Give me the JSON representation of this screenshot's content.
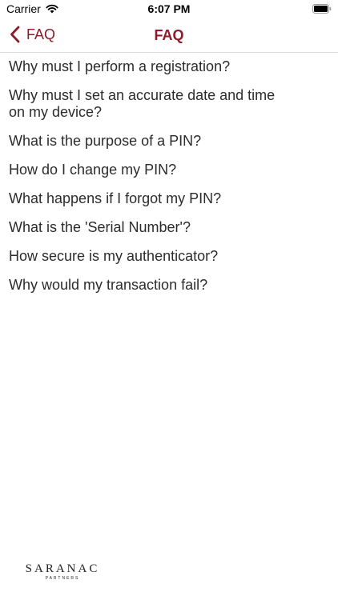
{
  "status_bar": {
    "carrier": "Carrier",
    "time": "6:07 PM"
  },
  "nav": {
    "back_label": "FAQ",
    "title": "FAQ",
    "accent_color": "#8a1c2b"
  },
  "faq": {
    "items": [
      "Why must I perform a registration?",
      "Why must I set an accurate date and time on my device?",
      "What is the purpose of a PIN?",
      "How do I change my PIN?",
      "What happens if I forgot my PIN?",
      "What is the 'Serial Number'?",
      "How secure is my authenticator?",
      "Why would my transaction fail?"
    ]
  },
  "logo": {
    "name": "SARANAC",
    "subtitle": "PARTNERS"
  },
  "icons": {
    "wifi": "wifi-icon",
    "battery": "battery-icon",
    "back": "chevron-left-icon"
  }
}
